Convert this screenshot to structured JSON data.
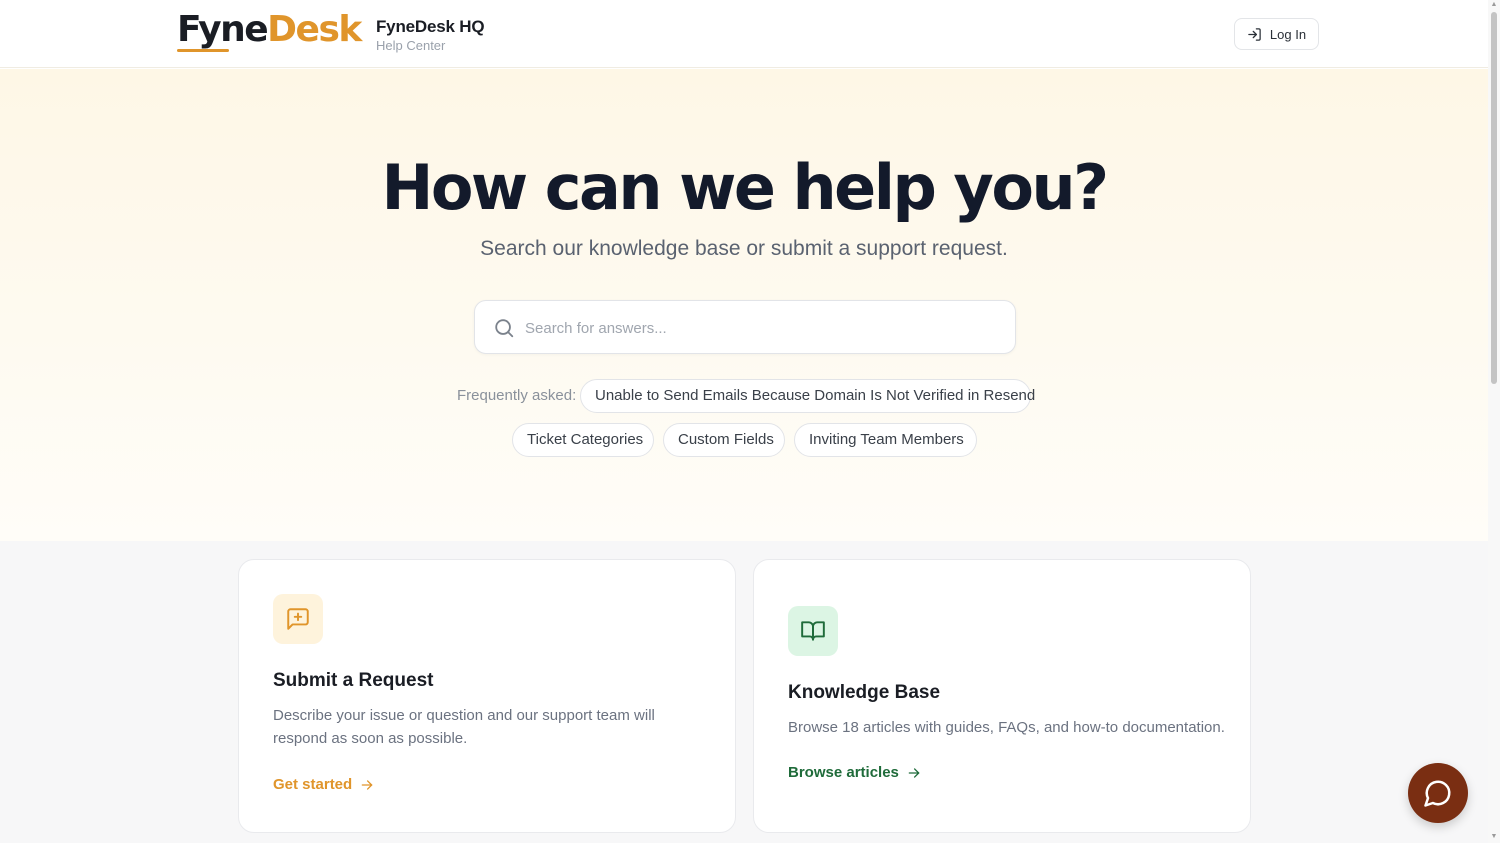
{
  "header": {
    "logo_part1": "Fyne",
    "logo_part2": "Desk",
    "brand_title": "FyneDesk HQ",
    "brand_subtitle": "Help Center",
    "login_label": "Log In",
    "login_icon": "log-in-icon"
  },
  "hero": {
    "title": "How can we help you?",
    "subtitle": "Search our knowledge base or submit a support request.",
    "search_placeholder": "Search for answers...",
    "search_value": "",
    "search_icon": "search-icon",
    "faq_label": "Frequently asked:",
    "faq_chips": [
      "Unable to Send Emails Because Domain Is Not Verified in Resend",
      "Ticket Categories",
      "Custom Fields",
      "Inviting Team Members"
    ]
  },
  "cards": [
    {
      "icon": "message-plus-icon",
      "title": "Submit a Request",
      "description": "Describe your issue or question and our support team will respond as soon as possible.",
      "link_label": "Get started",
      "accent": "#e0952b",
      "icon_bg": "#fef3dc"
    },
    {
      "icon": "book-open-icon",
      "title": "Knowledge Base",
      "description": "Browse 18 articles with guides, FAQs, and how-to documentation.",
      "link_label": "Browse articles",
      "accent": "#1f6b3a",
      "icon_bg": "#dcf5e4"
    }
  ],
  "chat": {
    "icon": "chat-bubble-icon",
    "color": "#7a2e12"
  },
  "colors": {
    "brand_dark": "#1a1d24",
    "brand_orange": "#e0952b",
    "hero_bg": "#fef7e6",
    "section_bg": "#f7f7f8"
  }
}
